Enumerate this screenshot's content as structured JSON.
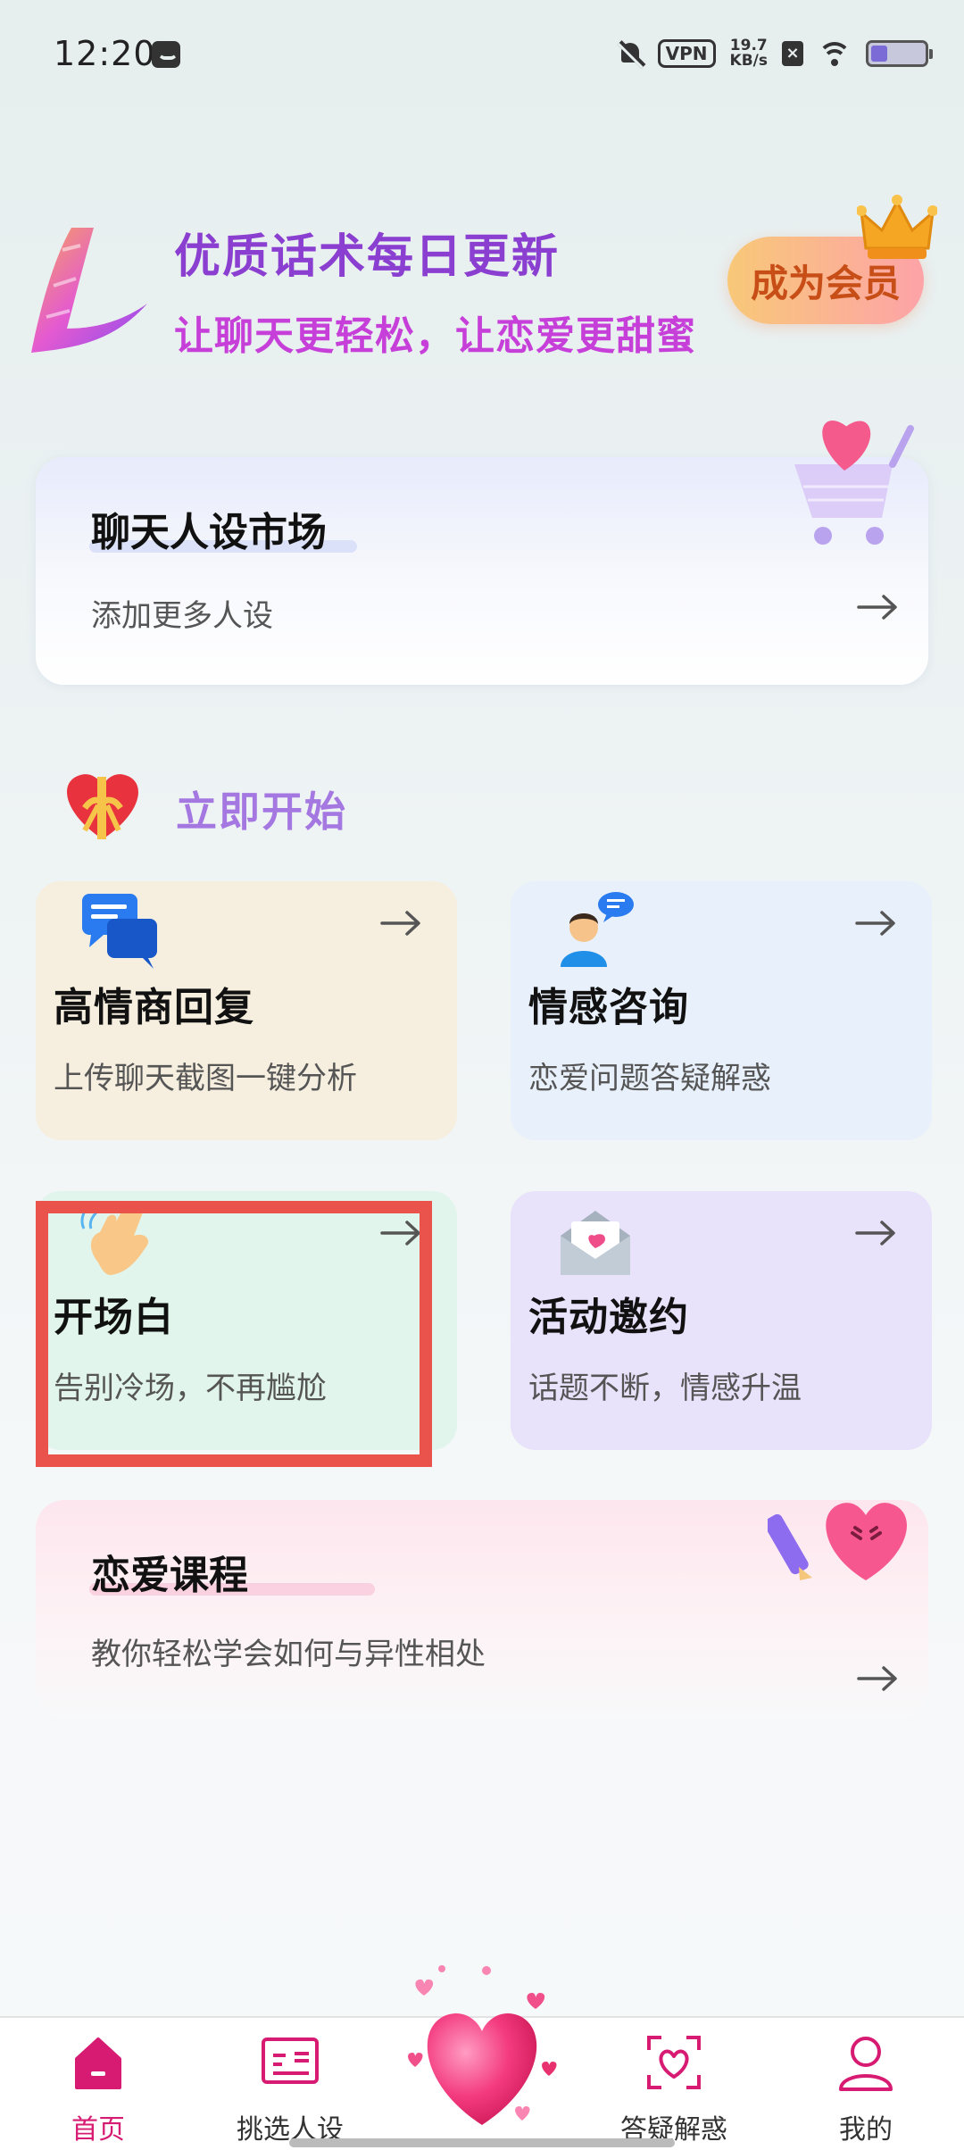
{
  "status_bar": {
    "time": "12:20",
    "vpn": "VPN",
    "speed_value": "19.7",
    "speed_unit": "KB/s"
  },
  "header": {
    "title": "优质话术每日更新",
    "subtitle": "让聊天更轻松，让恋爱更甜蜜",
    "vip_label": "成为会员"
  },
  "market_card": {
    "title": "聊天人设市场",
    "subtitle": "添加更多人设"
  },
  "section": {
    "title": "立即开始"
  },
  "features": [
    {
      "title": "高情商回复",
      "subtitle": "上传聊天截图一键分析"
    },
    {
      "title": "情感咨询",
      "subtitle": "恋爱问题答疑解惑"
    },
    {
      "title": "开场白",
      "subtitle": "告别冷场，不再尴尬"
    },
    {
      "title": "活动邀约",
      "subtitle": "话题不断，情感升温"
    }
  ],
  "course_card": {
    "title": "恋爱课程",
    "subtitle": "教你轻松学会如何与异性相处"
  },
  "nav": {
    "items": [
      {
        "label": "首页",
        "icon": "home-icon",
        "active": true
      },
      {
        "label": "挑选人设",
        "icon": "id-card-icon",
        "active": false
      },
      {
        "label": "答疑解惑",
        "icon": "heart-scan-icon",
        "active": false
      },
      {
        "label": "我的",
        "icon": "user-icon",
        "active": false
      }
    ]
  },
  "colors": {
    "accent": "#d81b72",
    "highlight": "#ea524c"
  }
}
